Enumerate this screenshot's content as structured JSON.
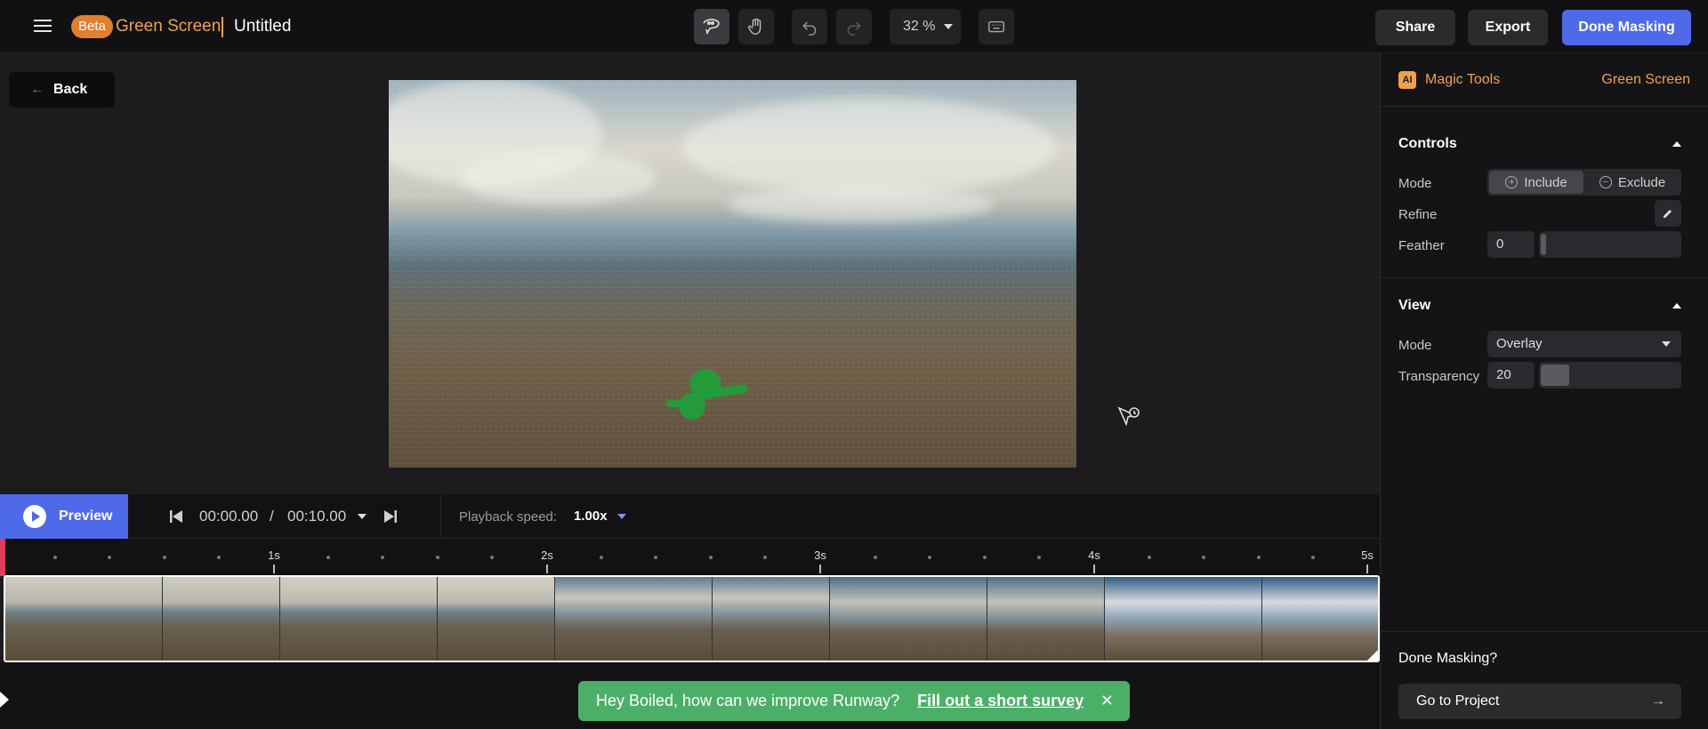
{
  "header": {
    "badge": "Beta",
    "app_name": "Green Screen",
    "doc_title": "Untitled",
    "zoom": "32 %",
    "share_label": "Share",
    "export_label": "Export",
    "done_label": "Done Masking"
  },
  "canvas": {
    "back_label": "Back"
  },
  "sidebar": {
    "ai_badge": "AI",
    "magic_tools": "Magic Tools",
    "green_screen": "Green Screen",
    "controls": {
      "title": "Controls",
      "mode_label": "Mode",
      "include": "Include",
      "exclude": "Exclude",
      "refine_label": "Refine",
      "feather_label": "Feather",
      "feather_value": "0"
    },
    "view": {
      "title": "View",
      "mode_label": "Mode",
      "mode_value": "Overlay",
      "transparency_label": "Transparency",
      "transparency_value": "20"
    },
    "done_question": "Done Masking?",
    "go_to_project": "Go to Project"
  },
  "transport": {
    "preview": "Preview",
    "current_time": "00:00.00",
    "separator": "/",
    "duration": "00:10.00",
    "speed_label": "Playback speed:",
    "speed_value": "1.00x"
  },
  "ruler": {
    "labels": [
      "1s",
      "2s",
      "3s",
      "4s",
      "5s"
    ]
  },
  "toast": {
    "message": "Hey Boiled, how can we improve Runway?",
    "link": "Fill out a short survey",
    "close": "✕"
  },
  "colors": {
    "accent": "#4f6ae8",
    "brand_orange": "#f0a04c",
    "toast": "#4caf68",
    "playhead": "#e23a5d",
    "mask": "#1e9f3a"
  }
}
